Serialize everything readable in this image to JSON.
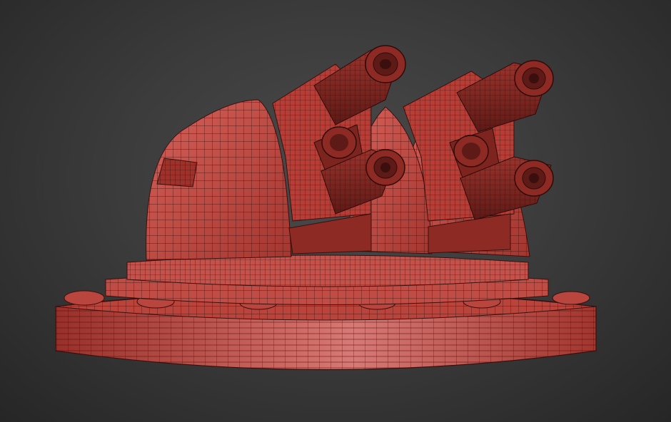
{
  "viewport": {
    "background_color": "#3b3b3b",
    "model": {
      "subject": "turret-wireframe-render",
      "surface_color": "#c0473f",
      "wire_color": "#3a0f0d",
      "highlight_color": "#e08a86",
      "shadow_color": "#6e1d19"
    }
  }
}
